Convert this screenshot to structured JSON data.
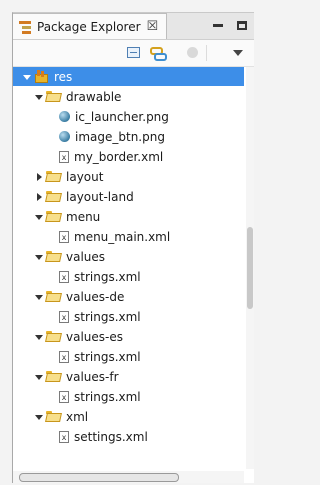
{
  "view": {
    "tab_label": "Package Explorer",
    "tab_close": "☒"
  },
  "tree": {
    "root": "res",
    "items": [
      {
        "label": "drawable"
      },
      {
        "label": "ic_launcher.png"
      },
      {
        "label": "image_btn.png"
      },
      {
        "label": "my_border.xml"
      },
      {
        "label": "layout"
      },
      {
        "label": "layout-land"
      },
      {
        "label": "menu"
      },
      {
        "label": "menu_main.xml"
      },
      {
        "label": "values"
      },
      {
        "label": "strings.xml"
      },
      {
        "label": "values-de"
      },
      {
        "label": "strings.xml"
      },
      {
        "label": "values-es"
      },
      {
        "label": "strings.xml"
      },
      {
        "label": "values-fr"
      },
      {
        "label": "strings.xml"
      },
      {
        "label": "xml"
      },
      {
        "label": "settings.xml"
      }
    ]
  },
  "colors": {
    "selection": "#3d8ee8",
    "folder": "#e8b52c"
  }
}
